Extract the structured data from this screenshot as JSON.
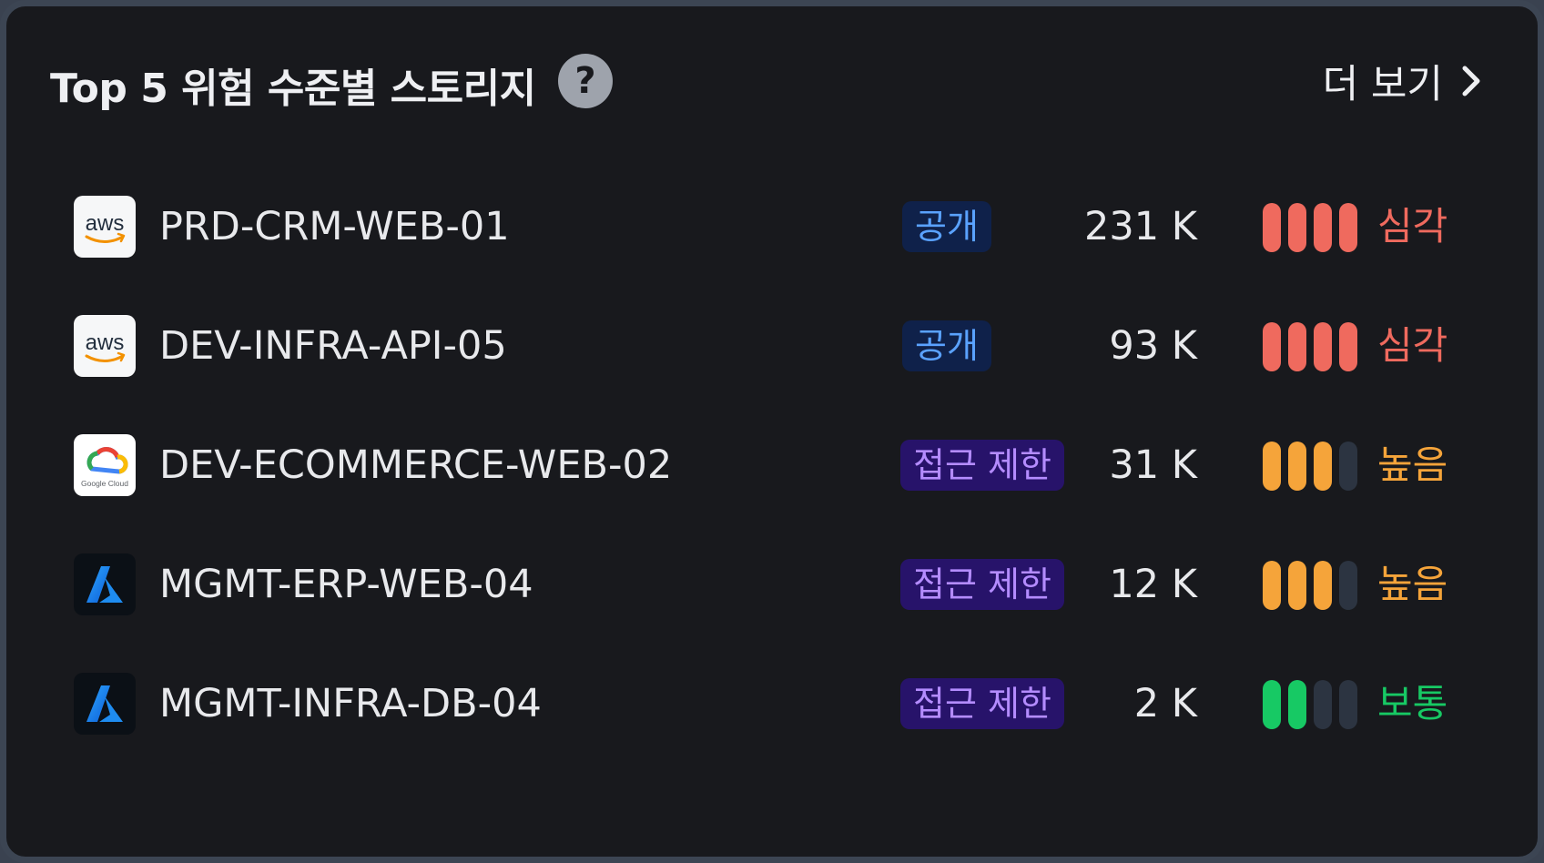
{
  "header": {
    "title": "Top 5 위험 수준별 스토리지",
    "help_label": "?",
    "more_label": "더 보기"
  },
  "colors": {
    "critical": "#ef6a5e",
    "high": "#f5a43a",
    "medium": "#17c964",
    "inactive_bar": "#2c3441"
  },
  "rows": [
    {
      "provider": "aws",
      "provider_logo_text": "aws",
      "name": "PRD-CRM-WEB-01",
      "access": "공개",
      "access_type": "public",
      "size": "231 K",
      "risk_level": 4,
      "risk_max": 4,
      "risk_label": "심각",
      "risk_color": "#ef6a5e"
    },
    {
      "provider": "aws",
      "provider_logo_text": "aws",
      "name": "DEV-INFRA-API-05",
      "access": "공개",
      "access_type": "public",
      "size": "93 K",
      "risk_level": 4,
      "risk_max": 4,
      "risk_label": "심각",
      "risk_color": "#ef6a5e"
    },
    {
      "provider": "gcp",
      "provider_logo_text": "Google Cloud",
      "name": "DEV-ECOMMERCE-WEB-02",
      "access": "접근 제한",
      "access_type": "restricted",
      "size": "31 K",
      "risk_level": 3,
      "risk_max": 4,
      "risk_label": "높음",
      "risk_color": "#f5a43a"
    },
    {
      "provider": "azure",
      "provider_logo_text": "",
      "name": "MGMT-ERP-WEB-04",
      "access": "접근 제한",
      "access_type": "restricted",
      "size": "12 K",
      "risk_level": 3,
      "risk_max": 4,
      "risk_label": "높음",
      "risk_color": "#f5a43a"
    },
    {
      "provider": "azure",
      "provider_logo_text": "",
      "name": "MGMT-INFRA-DB-04",
      "access": "접근 제한",
      "access_type": "restricted",
      "size": "2 K",
      "risk_level": 2,
      "risk_max": 4,
      "risk_label": "보통",
      "risk_color": "#17c964"
    }
  ]
}
